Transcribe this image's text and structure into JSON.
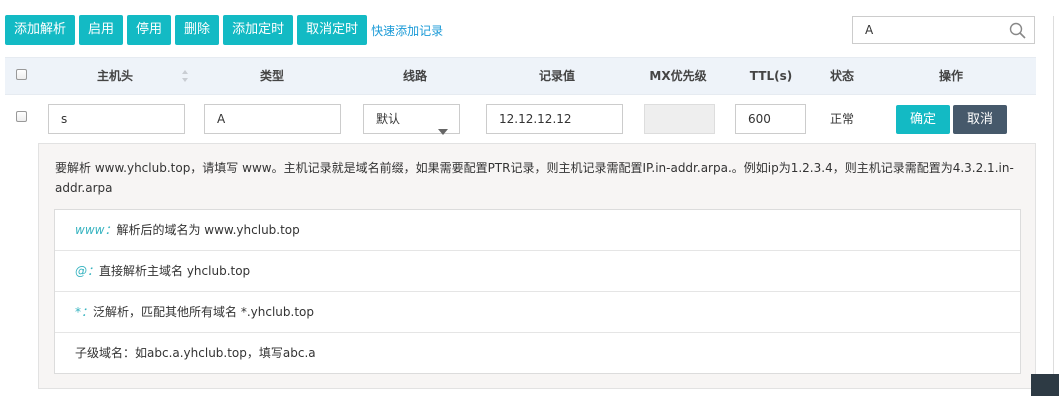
{
  "toolbar": {
    "buttons": [
      "添加解析",
      "启用",
      "停用",
      "删除",
      "添加定时",
      "取消定时"
    ],
    "quick_link": "快速添加记录"
  },
  "search": {
    "value": "A",
    "icon": "search-icon"
  },
  "table": {
    "headers": [
      "主机头",
      "类型",
      "线路",
      "记录值",
      "MX优先级",
      "TTL(s)",
      "状态",
      "操作"
    ],
    "row": {
      "host": "s",
      "type": "A",
      "line": "默认",
      "value": "12.12.12.12",
      "mx": "",
      "ttl": "600",
      "status": "正常",
      "confirm_label": "确定",
      "cancel_label": "取消"
    }
  },
  "help": {
    "intro": "要解析 www.yhclub.top，请填写 www。主机记录就是域名前缀，如果需要配置PTR记录，则主机记录需配置IP.in-addr.arpa.。例如ip为1.2.3.4，则主机记录需配置为4.3.2.1.in-addr.arpa",
    "items": [
      {
        "key": "www：",
        "text": "解析后的域名为 www.yhclub.top"
      },
      {
        "key": "@：",
        "text": "直接解析主域名 yhclub.top"
      },
      {
        "key": "*：",
        "text": "泛解析，匹配其他所有域名 *.yhclub.top"
      },
      {
        "key": "",
        "text": "子级域名：如abc.a.yhclub.top，填写abc.a"
      }
    ]
  },
  "colors": {
    "accent": "#13bac4",
    "cancel": "#46596b",
    "link": "#1a9ad7",
    "header_bg": "#eef3f9"
  }
}
